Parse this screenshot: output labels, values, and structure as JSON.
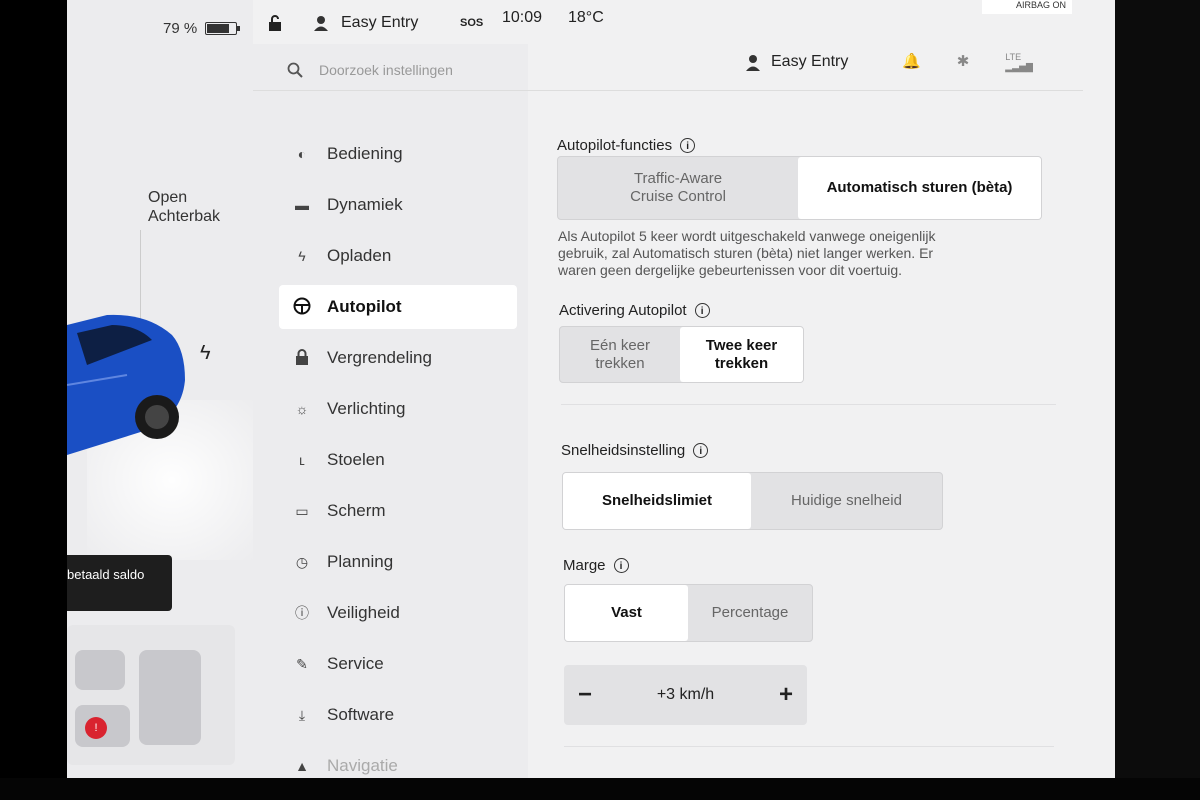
{
  "status": {
    "battery_percent": "79 %",
    "battery_level": 0.79,
    "profile": "Easy Entry",
    "sos": "SOS",
    "time": "10:09",
    "temperature": "18°C",
    "airbag": "AIRBAG ON"
  },
  "car_panel": {
    "trunk_line1": "Open",
    "trunk_line2": "Achterbak",
    "saldo": "betaald saldo"
  },
  "search": {
    "placeholder": "Doorzoek instellingen"
  },
  "user": {
    "name": "Easy Entry",
    "signal": "LTE"
  },
  "nav": {
    "items": [
      {
        "label": "Bediening",
        "icon": "toggle-icon"
      },
      {
        "label": "Dynamiek",
        "icon": "car-icon"
      },
      {
        "label": "Opladen",
        "icon": "bolt-icon"
      },
      {
        "label": "Autopilot",
        "icon": "steering-wheel-icon"
      },
      {
        "label": "Vergrendeling",
        "icon": "lock-icon"
      },
      {
        "label": "Verlichting",
        "icon": "sun-icon"
      },
      {
        "label": "Stoelen",
        "icon": "seat-icon"
      },
      {
        "label": "Scherm",
        "icon": "display-icon"
      },
      {
        "label": "Planning",
        "icon": "clock-icon"
      },
      {
        "label": "Veiligheid",
        "icon": "alert-icon"
      },
      {
        "label": "Service",
        "icon": "wrench-icon"
      },
      {
        "label": "Software",
        "icon": "download-icon"
      },
      {
        "label": "Navigatie",
        "icon": "navigation-icon"
      }
    ]
  },
  "autopilot": {
    "features_title": "Autopilot-functies",
    "features_opt1_line1": "Traffic-Aware",
    "features_opt1_line2": "Cruise Control",
    "features_opt2": "Automatisch sturen (bèta)",
    "description_line1": "Als Autopilot 5 keer wordt uitgeschakeld vanwege oneigenlijk",
    "description_line2": "gebruik, zal Automatisch sturen (bèta) niet langer werken. Er",
    "description_line3": "waren geen dergelijke gebeurtenissen voor dit voertuig.",
    "activation_title": "Activering Autopilot",
    "activation_opt1_line1": "Eén keer",
    "activation_opt1_line2": "trekken",
    "activation_opt2_line1": "Twee keer",
    "activation_opt2_line2": "trekken",
    "speed_title": "Snelheidsinstelling",
    "speed_opt1": "Snelheidslimiet",
    "speed_opt2": "Huidige snelheid",
    "margin_title": "Marge",
    "margin_opt1": "Vast",
    "margin_opt2": "Percentage",
    "margin_value": "+3 km/h",
    "minus": "−",
    "plus": "+"
  }
}
